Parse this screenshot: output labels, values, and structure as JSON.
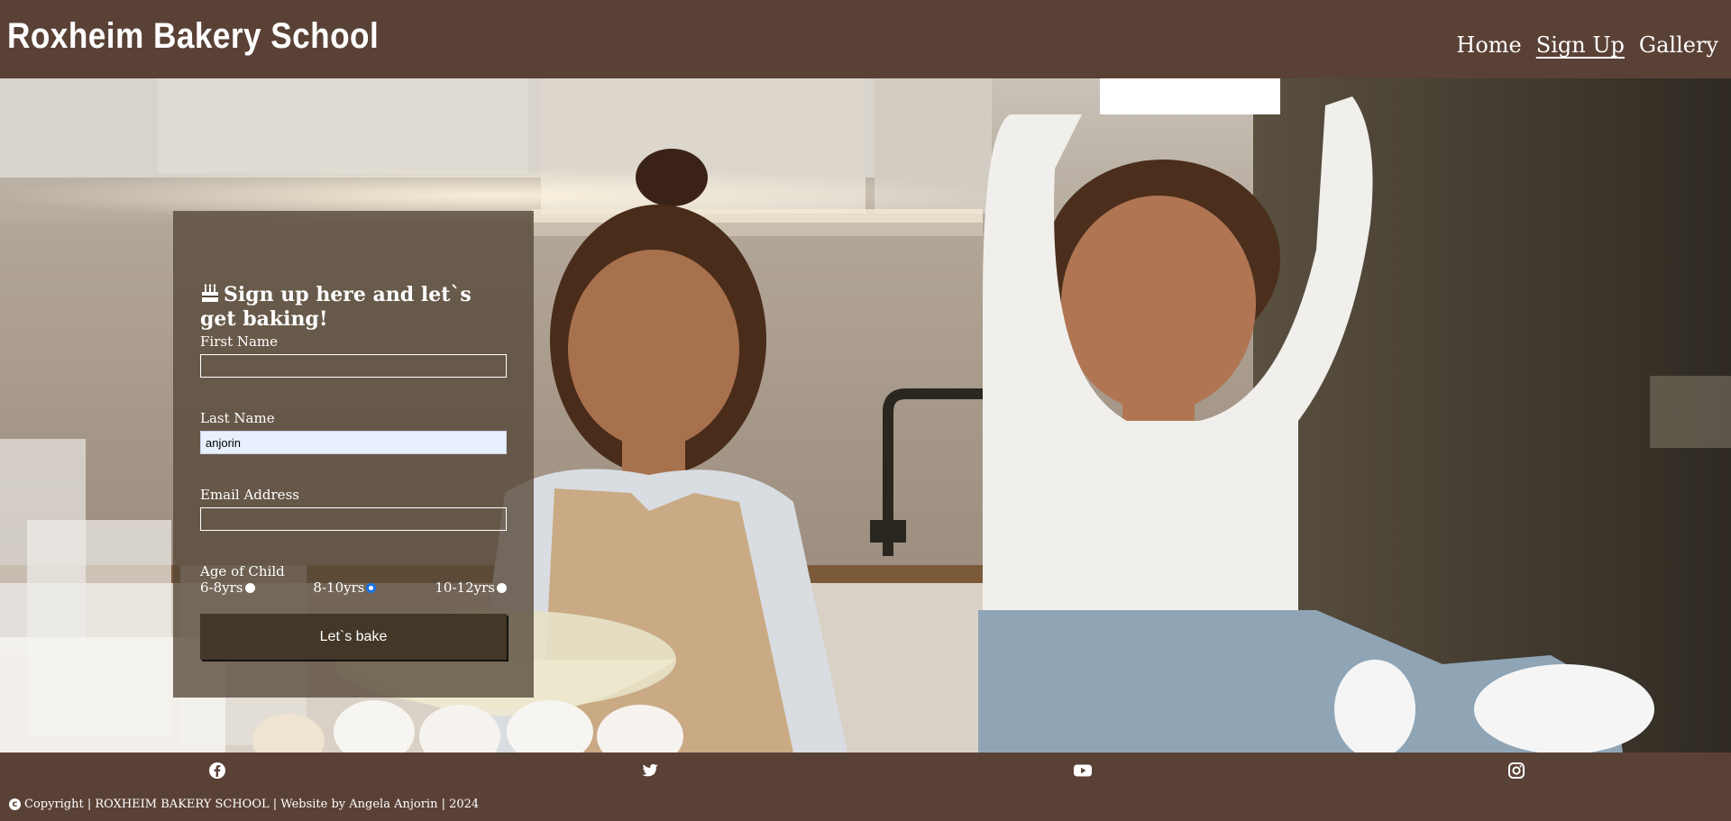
{
  "site": {
    "title": "Roxheim Bakery School"
  },
  "nav": {
    "items": [
      {
        "label": "Home",
        "active": false
      },
      {
        "label": "Sign Up",
        "active": true
      },
      {
        "label": "Gallery",
        "active": false
      }
    ]
  },
  "form": {
    "icon": "birthday-cake-icon",
    "title": "Sign up here and let`s get baking!",
    "first_name": {
      "label": "First Name",
      "value": ""
    },
    "last_name": {
      "label": "Last Name",
      "value": "anjorin"
    },
    "email": {
      "label": "Email Address",
      "value": ""
    },
    "age": {
      "label": "Age of Child",
      "options": [
        {
          "label": "6-8yrs",
          "checked": false
        },
        {
          "label": "8-10yrs",
          "checked": true
        },
        {
          "label": "10-12yrs",
          "checked": false
        }
      ]
    },
    "submit_label": "Let`s bake"
  },
  "footer": {
    "social_icons": [
      "facebook-icon",
      "twitter-icon",
      "youtube-icon",
      "instagram-icon"
    ],
    "copyright_icon": "copyright-icon",
    "copyright_text": "Copyright | ROXHEIM BAKERY SCHOOL | Website by Angela Anjorin | 2024"
  },
  "colors": {
    "brand_brown": "#5a4136",
    "form_panel": "#554637",
    "button": "#433728",
    "radio_accent": "#1a73e8",
    "autofill": "#e8f0fe"
  }
}
